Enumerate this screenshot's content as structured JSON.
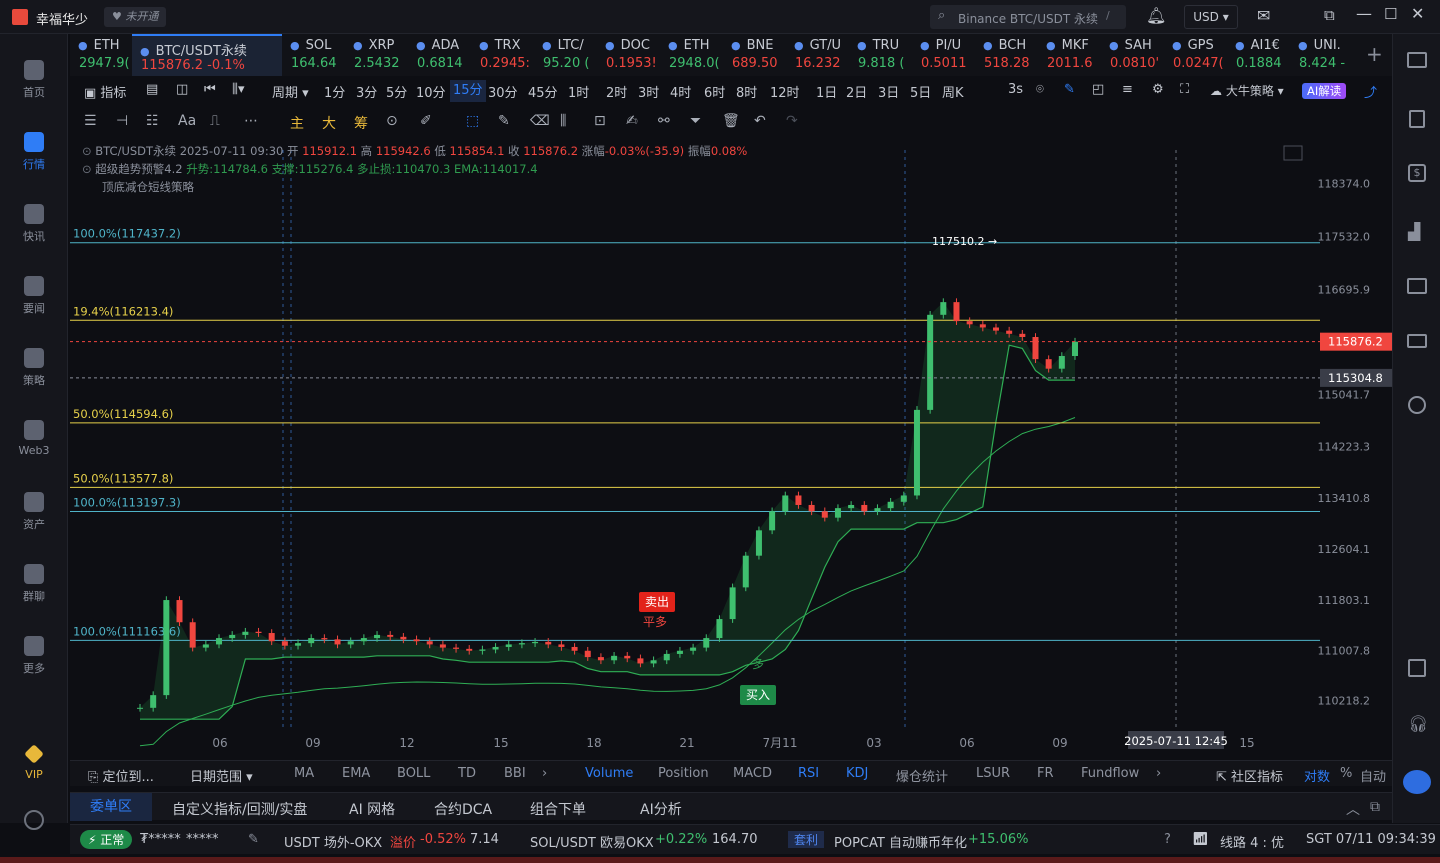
{
  "app": {
    "name": "幸福华少",
    "badge": "未开通",
    "search_placeholder": "Binance BTC/USDT 永续",
    "search_shortcut": "/",
    "currency": "USD"
  },
  "sidebar": {
    "items": [
      {
        "label": "首页",
        "icon": "home-icon"
      },
      {
        "label": "行情",
        "icon": "market-chart-icon",
        "active": true
      },
      {
        "label": "快讯",
        "icon": "news-icon"
      },
      {
        "label": "要闻",
        "icon": "headlines-icon"
      },
      {
        "label": "策略",
        "icon": "robot-icon"
      },
      {
        "label": "Web3",
        "icon": "web3-icon"
      },
      {
        "label": "资产",
        "icon": "wallet-icon"
      },
      {
        "label": "群聊",
        "icon": "chat-icon"
      },
      {
        "label": "更多",
        "icon": "grid-icon"
      },
      {
        "label": "VIP",
        "icon": "vip-diamond-icon"
      }
    ]
  },
  "tickers": [
    {
      "name": "ETH",
      "price": "2947.9(",
      "dir": "up"
    },
    {
      "name": "BTC/USDT永续",
      "price": "115876.2  -0.1%",
      "dir": "dn",
      "active": true
    },
    {
      "name": "SOL",
      "price": "164.64",
      "dir": "up"
    },
    {
      "name": "XRP",
      "price": "2.5432",
      "dir": "up"
    },
    {
      "name": "ADA",
      "price": "0.6814",
      "dir": "up"
    },
    {
      "name": "TRX",
      "price": "0.2945:",
      "dir": "dn"
    },
    {
      "name": "LTC/",
      "price": "95.20 (",
      "dir": "up"
    },
    {
      "name": "DOC",
      "price": "0.1953!",
      "dir": "dn"
    },
    {
      "name": "ETH",
      "price": "2948.0(",
      "dir": "up"
    },
    {
      "name": "BNE",
      "price": "689.50",
      "dir": "dn"
    },
    {
      "name": "GT/U",
      "price": "16.232",
      "dir": "dn"
    },
    {
      "name": "TRU",
      "price": "9.818 (",
      "dir": "up"
    },
    {
      "name": "PI/U",
      "price": "0.5011",
      "dir": "dn"
    },
    {
      "name": "BCH",
      "price": "518.28",
      "dir": "dn"
    },
    {
      "name": "MKF",
      "price": "2011.6",
      "dir": "dn"
    },
    {
      "name": "SAH",
      "price": "0.0810'",
      "dir": "dn"
    },
    {
      "name": "GPS",
      "price": "0.0247(",
      "dir": "dn"
    },
    {
      "name": "AI1€",
      "price": "0.1884",
      "dir": "up"
    },
    {
      "name": "UNI.",
      "price": "8.424 -",
      "dir": "up"
    }
  ],
  "toolbar": {
    "indicator": "指标",
    "period": "周期",
    "timeframes": [
      "1分",
      "3分",
      "5分",
      "10分",
      "15分",
      "30分",
      "45分",
      "1时",
      "2时",
      "3时",
      "4时",
      "6时",
      "8时",
      "12时",
      "1日",
      "2日",
      "3日",
      "5日",
      "周K"
    ],
    "selected_tf": "15分",
    "refresh": "3s",
    "strategy": "大牛策略",
    "ai": "AI解读"
  },
  "drawtools": {
    "items": [
      "主",
      "大",
      "筹"
    ]
  },
  "info": {
    "line1_symbol": "BTC/USDT永续 2025-07-11 09:30",
    "open_label": "开",
    "open": "115912.1",
    "high_label": "高",
    "high": "115942.6",
    "low_label": "低",
    "low": "115854.1",
    "close_label": "收",
    "close": "115876.2",
    "chg_label": "涨幅",
    "chg": "-0.03%(-35.9)",
    "amp_label": "振幅",
    "amp": "0.08%",
    "line2_name": "超级趋势预警4.2",
    "line2_vals": "升势:114784.6 支撑:115276.4 多止损:110470.3 EMA:114017.4",
    "line3_name": "顶底减仓短线策略"
  },
  "chart_data": {
    "type": "candlestick",
    "symbol": "BTC/USDT永续",
    "y_ticks": [
      118374.0,
      117532.0,
      116695.9,
      115041.7,
      114223.3,
      113410.8,
      112604.1,
      111803.1,
      111007.8,
      110218.2
    ],
    "ylim": [
      109750,
      118900
    ],
    "x_ticks": [
      "06",
      "09",
      "12",
      "15",
      "18",
      "21",
      "7月11",
      "03",
      "06",
      "09",
      "15"
    ],
    "current_price": "115876.2",
    "crosshair_price": "115304.8",
    "crosshair_time": "2025-07-11 12:45",
    "fib_levels": [
      {
        "label": "100.0%(117437.2)",
        "value": 117437.2,
        "color": "#4fb3c8"
      },
      {
        "label": "19.4%(116213.4)",
        "value": 116213.4,
        "color": "#e6d04a"
      },
      {
        "label": "50.0%(114594.6)",
        "value": 114594.6,
        "color": "#e6d04a"
      },
      {
        "label": "50.0%(113577.8)",
        "value": 113577.8,
        "color": "#e6d04a"
      },
      {
        "label": "100.0%(113197.3)",
        "value": 113197.3,
        "color": "#4fb3c8"
      },
      {
        "label": "100.0%(111163.6)",
        "value": 111163.6,
        "color": "#4fb3c8"
      }
    ],
    "high_marker": "117510.2 →",
    "signals": {
      "sell": "卖出",
      "flat": "平多",
      "long": "多",
      "buy": "买入"
    },
    "series_close": [
      110100,
      110300,
      111800,
      111450,
      111050,
      111100,
      111200,
      111250,
      111300,
      111280,
      111150,
      111080,
      111120,
      111200,
      111180,
      111100,
      111150,
      111200,
      111250,
      111220,
      111180,
      111150,
      111100,
      111050,
      111030,
      111000,
      111020,
      111060,
      111100,
      111120,
      111140,
      111100,
      111060,
      111000,
      110900,
      110850,
      110920,
      110880,
      110800,
      110850,
      110950,
      111000,
      111050,
      111200,
      111500,
      112000,
      112500,
      112900,
      113200,
      113450,
      113300,
      113200,
      113100,
      113250,
      113300,
      113200,
      113250,
      113350,
      113450,
      114800,
      116300,
      116500,
      116200,
      116150,
      116100,
      116050,
      116000,
      115950,
      115600,
      115450,
      115650,
      115876
    ]
  },
  "subtabs": {
    "locate": "定位到...",
    "range": "日期范围",
    "items": [
      "MA",
      "EMA",
      "BOLL",
      "TD",
      "BBI"
    ],
    "right_items": [
      "Volume",
      "Position",
      "MACD",
      "RSI",
      "KDJ",
      "爆仓统计",
      "LSUR",
      "FR",
      "Fundflow"
    ],
    "community": "社区指标",
    "auto": "自动",
    "log": "对数",
    "pct": "%"
  },
  "bottomtabs": [
    "委单区",
    "自定义指标/回测/实盘",
    "AI 网格",
    "合约DCA",
    "组合下单",
    "AI分析"
  ],
  "status": {
    "state": "正常",
    "user": "₮*****",
    "mask": "*****",
    "i1_name": "USDT 场外-OKX",
    "i1_label": "溢价",
    "i1_pct": "-0.52%",
    "i1_val": "7.14",
    "i2_name": "SOL/USDT 欧易OKX",
    "i2_pct": "+0.22%",
    "i2_val": "164.70",
    "i3_badge": "套利",
    "i3_name": "POPCAT 自动赚币年化",
    "i3_pct": "+15.06%",
    "line": "线路 4 : 优",
    "time": "SGT 07/11 09:34:39"
  }
}
